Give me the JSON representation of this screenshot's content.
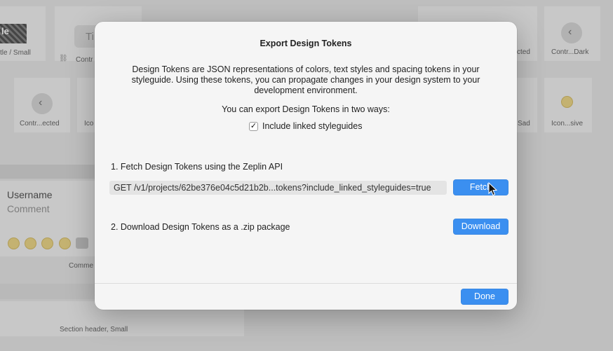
{
  "background": {
    "captions": {
      "tile_1": "tle / Small",
      "tile_2": "Contr",
      "tile_3": "cted",
      "tile_4": "Contr...Dark",
      "tile_5": "Contr...ected",
      "tile_6": "Ico",
      "tile_7": "Sad",
      "tile_8": "Icon...sive",
      "comment_caption": "Comme",
      "section_header": "Section header, Small"
    },
    "hatch_label": "le",
    "title_pill_label": "Ti",
    "username": "Username",
    "comment": "Comment"
  },
  "dialog": {
    "title": "Export Design Tokens",
    "description": "Design Tokens are JSON representations of colors, text styles and spacing tokens in your styleguide. Using these tokens, you can propagate changes in your design system to your development environment.",
    "ways_text": "You can export Design Tokens in two ways:",
    "include_linked": {
      "label": "Include linked styleguides",
      "checked": true,
      "check_glyph": "✓"
    },
    "step1_label": "1. Fetch Design Tokens using the Zeplin API",
    "api_url": "GET /v1/projects/62be376e04c5d21b2b...tokens?include_linked_styleguides=true",
    "fetch_label": "Fetch",
    "step2_label": "2. Download Design Tokens as a .zip package",
    "download_label": "Download",
    "done_label": "Done"
  },
  "colors": {
    "accent": "#3b8ff0",
    "dialog_bg": "#f5f5f5",
    "field_bg": "#e4e4e4"
  }
}
